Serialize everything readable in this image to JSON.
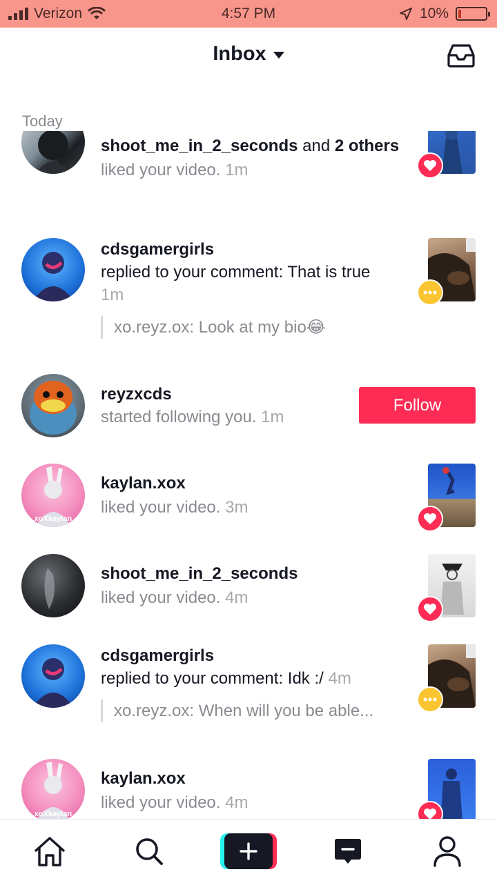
{
  "status_bar": {
    "carrier": "Verizon",
    "time": "4:57 PM",
    "battery": "10%"
  },
  "header": {
    "title": "Inbox"
  },
  "section_label": "Today",
  "notifications": [
    {
      "username": "shoot_me_in_2_seconds",
      "connector": " and ",
      "others": "2 others",
      "action": "liked your video.",
      "time": "1m",
      "badge": "heart"
    },
    {
      "username": "cdsgamergirls",
      "action": "replied to your comment: That is true",
      "time": "1m",
      "quote": "xo.reyz.ox: Look at my bio😂",
      "badge": "comment"
    },
    {
      "username": "reyzxcds",
      "action": "started following you.",
      "time": "1m",
      "button": "Follow"
    },
    {
      "username": "kaylan.xox",
      "action": "liked your video.",
      "time": "3m",
      "badge": "heart",
      "avatar_watermark": "xoXkaylan"
    },
    {
      "username": "shoot_me_in_2_seconds",
      "action": "liked your video.",
      "time": "4m",
      "badge": "heart"
    },
    {
      "username": "cdsgamergirls",
      "action": "replied to your comment: Idk :/",
      "time": "4m",
      "quote": "xo.reyz.ox: When will you be able...",
      "badge": "comment"
    },
    {
      "username": "kaylan.xox",
      "action": "liked your video.",
      "time": "4m",
      "badge": "heart",
      "avatar_watermark": "xoXkaylan"
    }
  ],
  "colors": {
    "accent": "#fe2c55",
    "comment_badge": "#fbc531",
    "status_bar": "#f9968b"
  },
  "bottom_nav": [
    "home-icon",
    "search-icon",
    "create-icon",
    "inbox-icon",
    "profile-icon"
  ]
}
